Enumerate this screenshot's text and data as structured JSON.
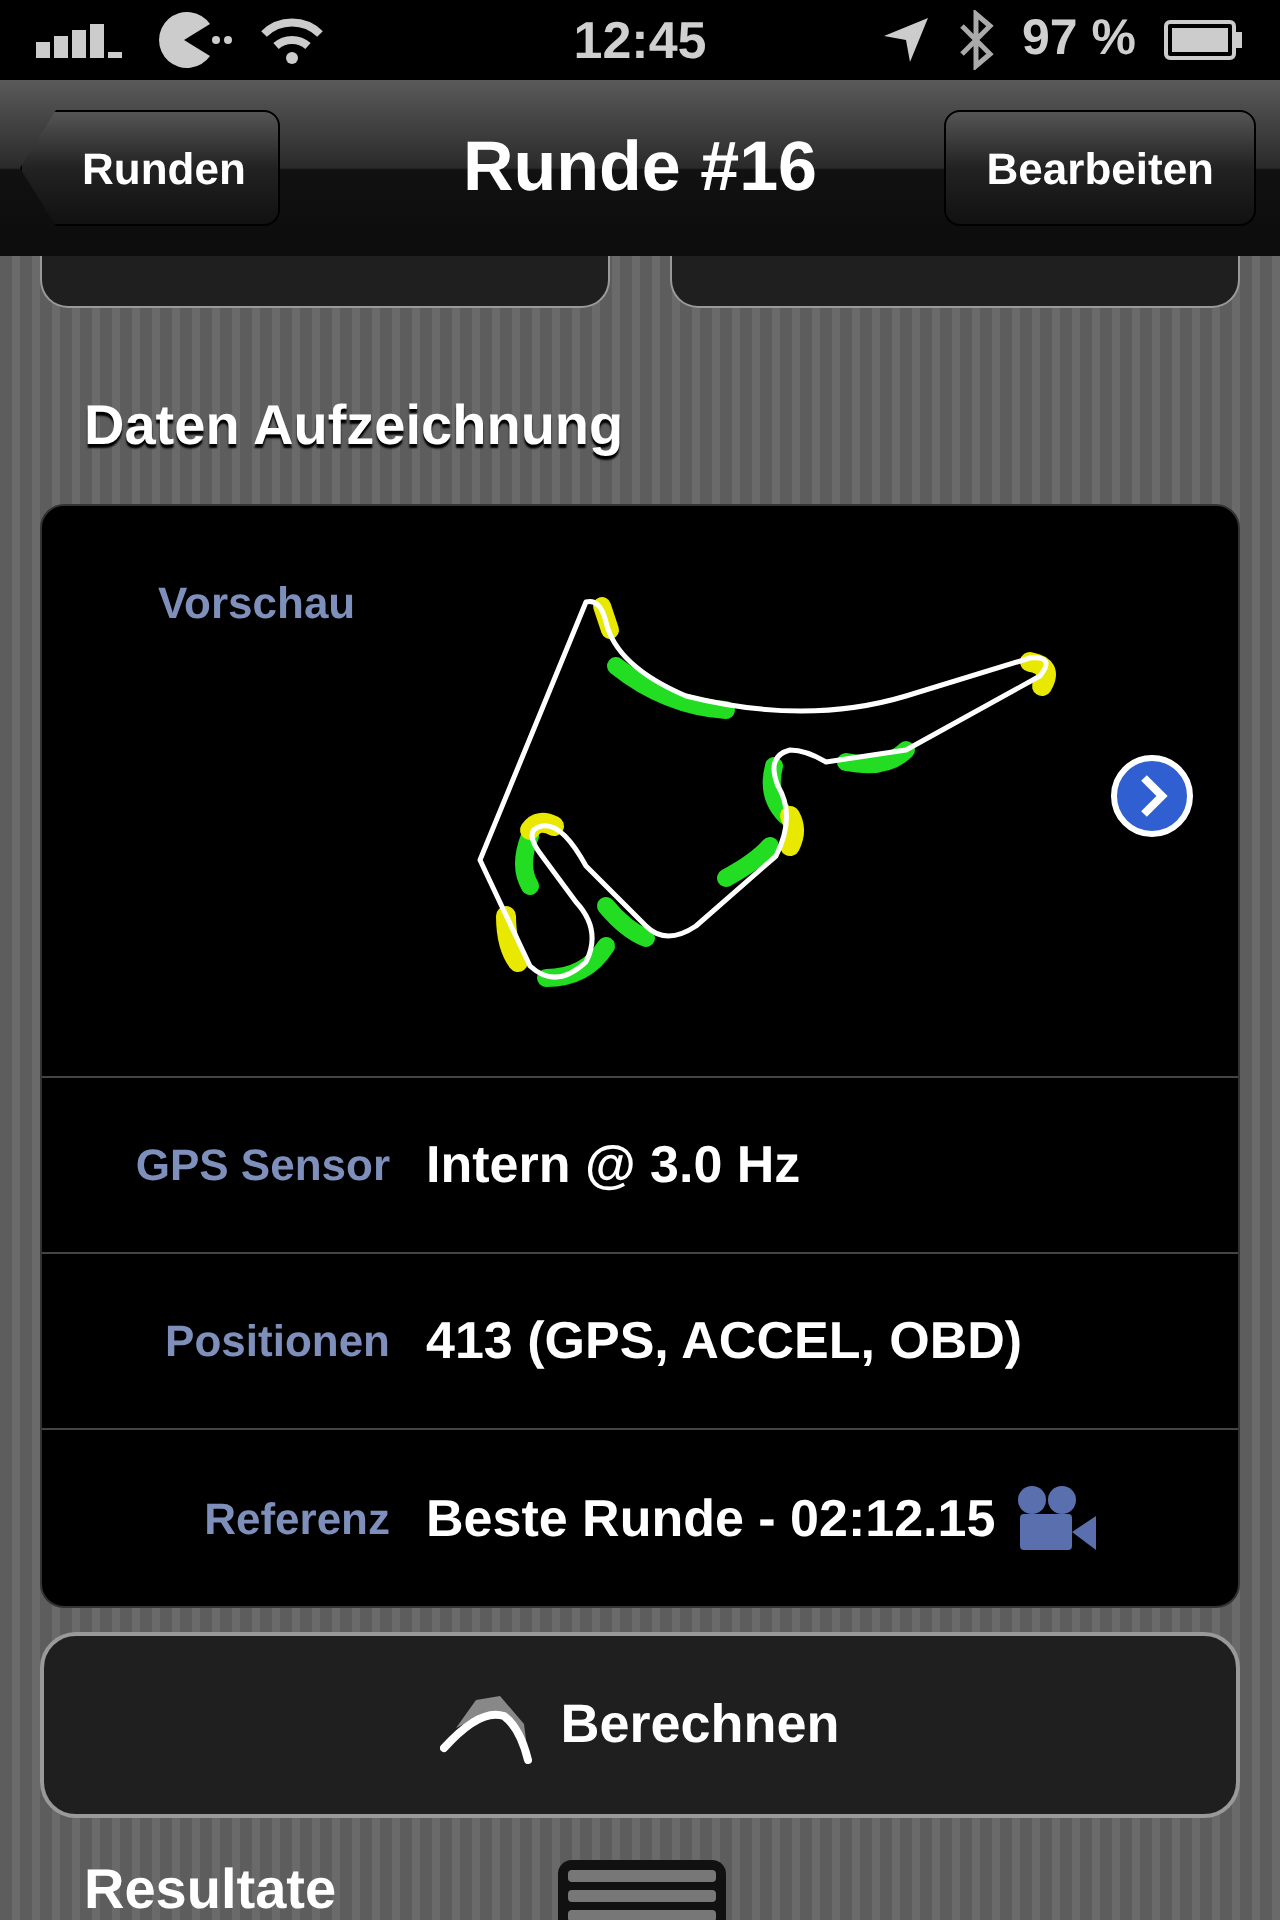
{
  "status_bar": {
    "time": "12:45",
    "battery": "97 %"
  },
  "nav_bar": {
    "back": "Runden",
    "title": "Runde #16",
    "action": "Bearbeiten"
  },
  "section_title": "Daten Aufzeichnung",
  "preview": {
    "label": "Vorschau"
  },
  "rows": [
    {
      "kind": "text",
      "label": "GPS Sensor",
      "value": "Intern @ 3.0 Hz"
    },
    {
      "kind": "text",
      "label": "Positionen",
      "value": "413 (GPS, ACCEL, OBD)"
    },
    {
      "kind": "video",
      "label": "Referenz",
      "value": "Beste Runde - 02:12.15"
    }
  ],
  "button": "Berechnen",
  "next_section": "Resultate"
}
